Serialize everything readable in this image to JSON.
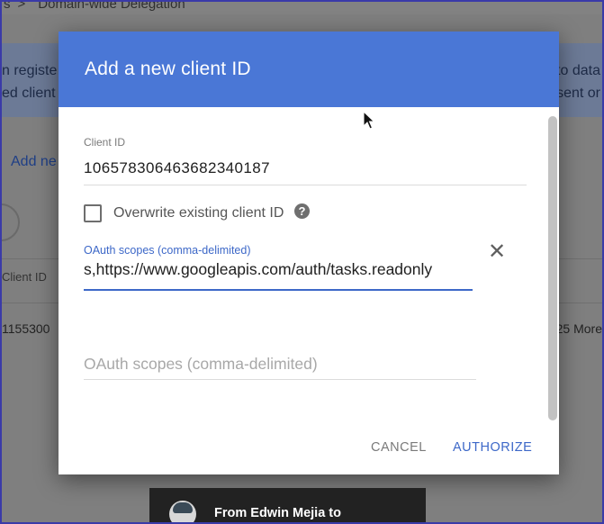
{
  "background": {
    "breadcrumb_prev": "s",
    "breadcrumb_sep": ">",
    "breadcrumb_current": "Domain-wide Delegation",
    "banner_left_line1": "n registe",
    "banner_left_line2": "ed client",
    "banner_right_line1": "to data",
    "banner_right_line2": "sent or",
    "add_link": "Add ne",
    "column_header": "Client ID",
    "row_client_partial": "1155300",
    "row_more_partial": "25 More"
  },
  "dialog": {
    "title": "Add a new client ID",
    "client_id_label": "Client ID",
    "client_id_value": "106578306463682340187",
    "overwrite_label": "Overwrite existing client ID",
    "help_glyph": "?",
    "scope_label": "OAuth scopes (comma-delimited)",
    "scope_value": "s,https://www.googleapis.com/auth/tasks.readonly",
    "remove_glyph": "✕",
    "scope_placeholder": "OAuth scopes (comma-delimited)",
    "cancel_label": "CANCEL",
    "authorize_label": "AUTHORIZE"
  },
  "toast": {
    "text": "From Edwin Mejia to"
  },
  "colors": {
    "header_blue": "#4a77d6",
    "accent_blue": "#3d68c8",
    "overlay_gray": "#7f7f7f"
  },
  "icons": {
    "help": "help-circle-icon",
    "remove": "close-icon",
    "cursor": "mouse-pointer-icon"
  }
}
